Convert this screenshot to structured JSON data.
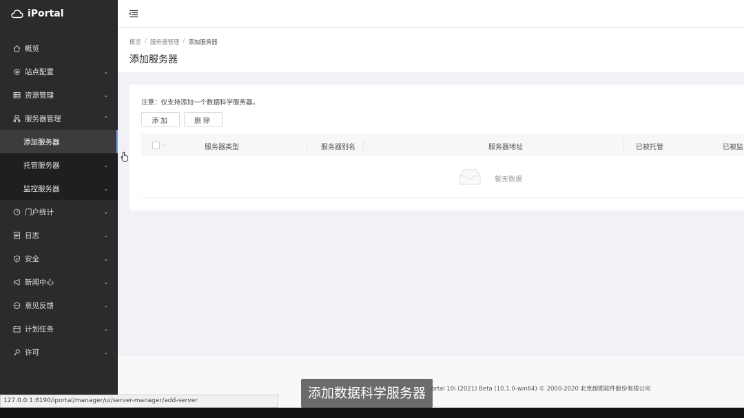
{
  "app": {
    "name": "iPortal"
  },
  "sidebar": {
    "items": [
      {
        "label": "概览",
        "icon": "home-icon",
        "chevron": false
      },
      {
        "label": "站点配置",
        "icon": "gear-icon",
        "chevron": true
      },
      {
        "label": "资源管理",
        "icon": "grid-icon",
        "chevron": true
      },
      {
        "label": "服务器管理",
        "icon": "server-icon",
        "chevron": true,
        "expanded": true,
        "children": [
          {
            "label": "添加服务器",
            "active": true
          },
          {
            "label": "托管服务器",
            "chevron": true
          },
          {
            "label": "监控服务器",
            "chevron": true
          }
        ]
      },
      {
        "label": "门户统计",
        "icon": "gauge-icon",
        "chevron": true
      },
      {
        "label": "日志",
        "icon": "log-icon",
        "chevron": true
      },
      {
        "label": "安全",
        "icon": "shield-icon",
        "chevron": true
      },
      {
        "label": "新闻中心",
        "icon": "megaphone-icon",
        "chevron": true
      },
      {
        "label": "意见反馈",
        "icon": "feedback-icon",
        "chevron": true
      },
      {
        "label": "计划任务",
        "icon": "calendar-icon",
        "chevron": true
      },
      {
        "label": "许可",
        "icon": "key-icon",
        "chevron": true
      }
    ]
  },
  "breadcrumb": [
    "概览",
    "服务器管理",
    "添加服务器"
  ],
  "page": {
    "title": "添加服务器",
    "notice": "注意：仅支持添加一个数据科学服务器。",
    "add_button": "添加",
    "delete_button": "删除"
  },
  "table": {
    "columns": [
      "服务器类型",
      "服务器别名",
      "服务器地址",
      "已被托管",
      "已被监"
    ],
    "empty_text": "暂无数据"
  },
  "footer": {
    "text": "ortal 10i (2021) Beta (10.1.0-win64) © 2000-2020 北京超图软件股份有限公司"
  },
  "status_bar": {
    "url": "127.0.0.1:8190/iportal/manager/ui/server-manager/add-server"
  },
  "caption": {
    "text": "添加数据科学服务器"
  },
  "colors": {
    "sidebar_bg": "#2b2b2b",
    "active_accent": "#6aa0ff"
  }
}
